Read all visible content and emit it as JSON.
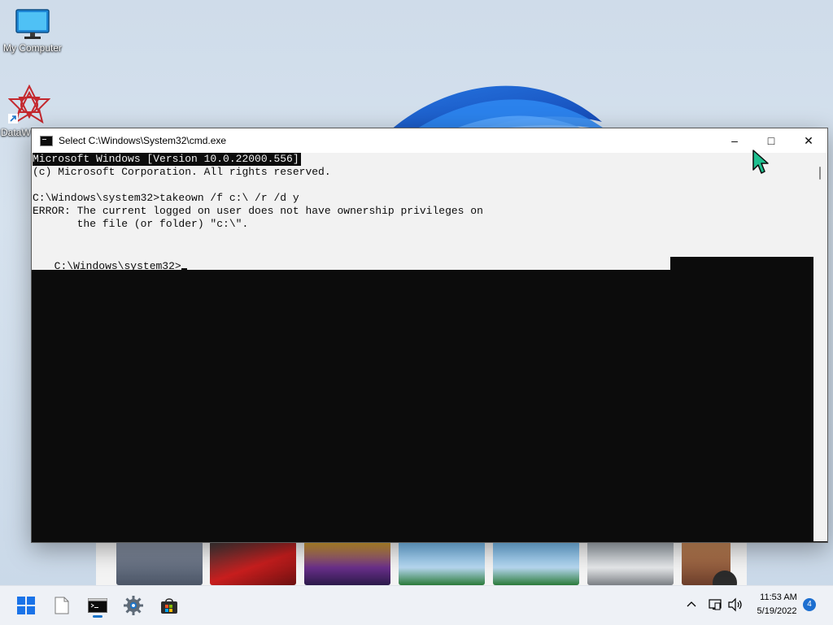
{
  "desktop": {
    "icons": [
      {
        "label": "My Computer"
      },
      {
        "label": "DataW"
      }
    ]
  },
  "window": {
    "title": "Select C:\\Windows\\System32\\cmd.exe",
    "controls": {
      "minimize": "–",
      "maximize": "□",
      "close": "✕"
    }
  },
  "console": {
    "lines": [
      "Microsoft Windows [Version 10.0.22000.556]",
      "(c) Microsoft Corporation. All rights reserved.",
      "",
      "C:\\Windows\\system32>takeown /f c:\\ /r /d y",
      "ERROR: The current logged on user does not have ownership privileges on",
      "       the file (or folder) \"c:\\\".",
      "",
      "C:\\Windows\\system32>"
    ]
  },
  "taskbar": {
    "apps": [
      {
        "name": "start",
        "icon": "windows-logo-icon"
      },
      {
        "name": "file",
        "icon": "file-icon"
      },
      {
        "name": "cmd",
        "icon": "terminal-icon",
        "active": true
      },
      {
        "name": "settings",
        "icon": "gear-icon"
      },
      {
        "name": "store",
        "icon": "store-bag-icon"
      }
    ],
    "tray": {
      "time": "11:53 AM",
      "date": "5/19/2022",
      "notifications": "4"
    }
  },
  "colors": {
    "console_bg": "#0c0c0c",
    "selection_bg": "#f2f2f2",
    "accent": "#1a73c8"
  }
}
